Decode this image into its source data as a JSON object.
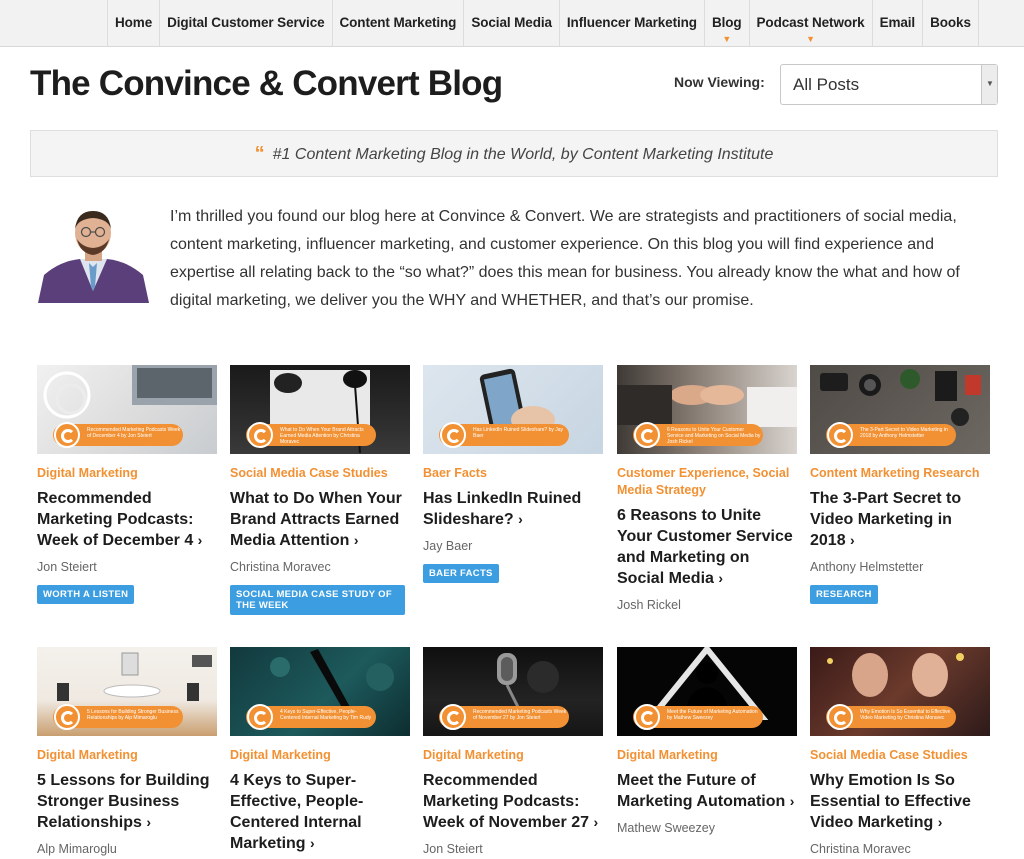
{
  "nav": {
    "items": [
      {
        "label": "Home",
        "caret": false
      },
      {
        "label": "Digital Customer Service",
        "caret": false
      },
      {
        "label": "Content Marketing",
        "caret": false
      },
      {
        "label": "Social Media",
        "caret": false
      },
      {
        "label": "Influencer Marketing",
        "caret": false
      },
      {
        "label": "Blog",
        "caret": true
      },
      {
        "label": "Podcast Network",
        "caret": true
      },
      {
        "label": "Email",
        "caret": false
      },
      {
        "label": "Books",
        "caret": false
      }
    ]
  },
  "header": {
    "title": "The Convince & Convert Blog",
    "viewing_label": "Now Viewing:",
    "viewing_value": "All Posts"
  },
  "quote": {
    "mark": "“",
    "text": "#1 Content Marketing Blog in the World, by Content Marketing Institute"
  },
  "intro": {
    "text": "I’m thrilled you found our blog here at Convince & Convert. We are strategists and practitioners of social media, content marketing, influencer marketing, and customer experience. On this blog you will find experience and expertise all relating back to the “so what?” does this mean for business. You already know the what and how of digital marketing, we deliver you the WHY and WHETHER, and that’s our promise."
  },
  "colors": {
    "accent": "#f29133",
    "tag": "#3c9ee0"
  },
  "posts": [
    {
      "category": "Digital Marketing",
      "title": "Recommended Marketing Podcasts: Week of December 4",
      "author": "Jon Steiert",
      "tag": "WORTH A LISTEN",
      "thumb_text": "Recommended Marketing Podcasts Week of December 4 by Jon Steiert"
    },
    {
      "category": "Social Media Case Studies",
      "title": "What to Do When Your Brand Attracts Earned Media Attention",
      "author": "Christina Moravec",
      "tag": "SOCIAL MEDIA CASE STUDY OF THE WEEK",
      "thumb_text": "What to Do When Your Brand Attracts Earned Media Attention by Christina Moravec"
    },
    {
      "category": "Baer Facts",
      "title": "Has LinkedIn Ruined Slideshare?",
      "author": "Jay Baer",
      "tag": "BAER FACTS",
      "thumb_text": "Has LinkedIn Ruined Slideshare? by Jay Baer"
    },
    {
      "category": "Customer Experience, Social Media Strategy",
      "title": "6 Reasons to Unite Your Customer Service and Marketing on Social Media",
      "author": "Josh Rickel",
      "tag": "",
      "thumb_text": "6 Reasons to Unite Your Customer Service and Marketing on Social Media by Josh Rickel"
    },
    {
      "category": "Content Marketing Research",
      "title": "The 3-Part Secret to Video Marketing in 2018",
      "author": "Anthony Helmstetter",
      "tag": "RESEARCH",
      "thumb_text": "The 3-Part Secret to Video Marketing in 2018 by Anthony Helmstetter"
    },
    {
      "category": "Digital Marketing",
      "title": "5 Lessons for Building Stronger Business Relationships",
      "author": "Alp Mimaroglu",
      "tag": "",
      "thumb_text": "5 Lessons for Building Stronger Business Relationships by Alp Mimaroglu"
    },
    {
      "category": "Digital Marketing",
      "title": "4 Keys to Super-Effective, People-Centered Internal Marketing",
      "author": "",
      "tag": "",
      "thumb_text": "4 Keys to Super-Effective, People-Centered Internal Marketing by Tim Rudy"
    },
    {
      "category": "Digital Marketing",
      "title": "Recommended Marketing Podcasts: Week of November 27",
      "author": "Jon Steiert",
      "tag": "",
      "thumb_text": "Recommended Marketing Podcasts Week of November 27 by Jon Steiert"
    },
    {
      "category": "Digital Marketing",
      "title": "Meet the Future of Marketing Automation",
      "author": "Mathew Sweezey",
      "tag": "",
      "thumb_text": "Meet the Future of Marketing Automation by Mathew Sweezey"
    },
    {
      "category": "Social Media Case Studies",
      "title": "Why Emotion Is So Essential to Effective Video Marketing",
      "author": "Christina Moravec",
      "tag": "",
      "thumb_text": "Why Emotion Is So Essential to Effective Video Marketing by Christina Moravec"
    }
  ]
}
